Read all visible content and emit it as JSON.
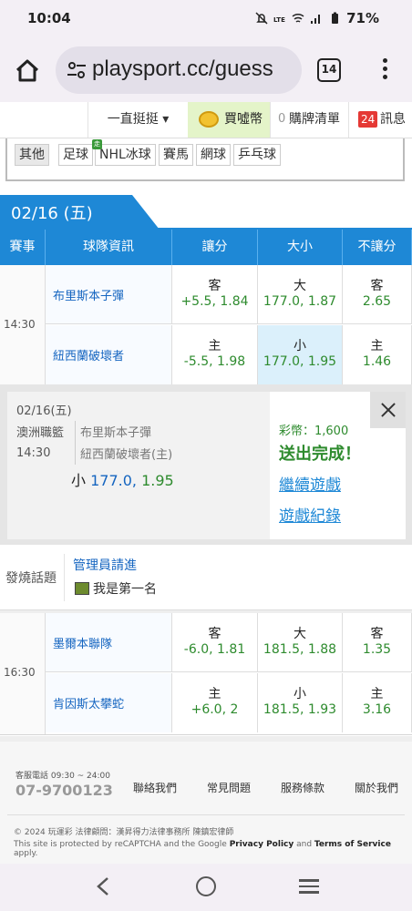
{
  "status_bar": {
    "time": "10:04",
    "battery": "71%"
  },
  "browser": {
    "url": "playsport.cc/guess",
    "tab_count": "14"
  },
  "site_nav": {
    "dropdown": "一直挺挺 ▾",
    "buy_coins": "買噓幣",
    "cart_count": "0",
    "cart": "購牌清單",
    "msg_count": "24",
    "messages": "訊息"
  },
  "sports": [
    "其他",
    "足球",
    "NHL冰球",
    "賽馬",
    "網球",
    "乒乓球"
  ],
  "sport_new_tag": "走",
  "date_tab": "02/16 (五)",
  "table_headers": [
    "賽事",
    "球隊資訊",
    "讓分",
    "大小",
    "不讓分"
  ],
  "games": [
    {
      "time": "14:30",
      "rows": [
        {
          "team": "布里斯本子彈",
          "spread_t": "客",
          "spread_v": "+5.5, 1.84",
          "total_t": "大",
          "total_v": "177.0, 1.87",
          "ml_t": "客",
          "ml_v": "2.65"
        },
        {
          "team": "紐西蘭破壞者",
          "spread_t": "主",
          "spread_v": "-5.5, 1.98",
          "total_t": "小",
          "total_v": "177.0, 1.95",
          "ml_t": "主",
          "ml_v": "1.46"
        }
      ]
    },
    {
      "time": "16:30",
      "rows": [
        {
          "team": "墨爾本聯隊",
          "spread_t": "客",
          "spread_v": "-6.0, 1.81",
          "total_t": "大",
          "total_v": "181.5, 1.88",
          "ml_t": "客",
          "ml_v": "1.35"
        },
        {
          "team": "肯因斯太攀蛇",
          "spread_t": "主",
          "spread_v": "+6.0, 2",
          "total_t": "小",
          "total_v": "181.5, 1.93",
          "ml_t": "主",
          "ml_v": "3.16"
        }
      ]
    }
  ],
  "bet_slip": {
    "date": "02/16(五)",
    "league": "澳洲職籃",
    "time": "14:30",
    "team1": "布里斯本子彈",
    "team2": "紐西蘭破壞者(主)",
    "pick_side": "小",
    "pick_line": "177.0,",
    "pick_odds": "1.95",
    "coins": "彩幣：1,600",
    "status": "送出完成！",
    "continue": "繼續遊戲",
    "records": "遊戲紀錄"
  },
  "hot_topic": {
    "label": "發燒話題",
    "title": "管理員請進",
    "first_post": "我是第一名"
  },
  "footer": {
    "tel_label": "客服電話 09:30 ~ 24:00",
    "tel": "07-9700123",
    "links": [
      "聯絡我們",
      "常見問題",
      "服務條款",
      "關於我們"
    ],
    "copyright": "© 2024 玩運彩 法律顧問：漢昇得力法律事務所 陳鎮宏律師",
    "recaptcha_pre": "This site is protected by reCAPTCHA and the Google",
    "privacy": "Privacy Policy",
    "and": "and",
    "terms": "Terms of Service",
    "apply": "apply."
  },
  "colors": {
    "primary_blue": "#1e88d6",
    "odds_green": "#2e8b2e",
    "team_blue": "#1565c0"
  }
}
